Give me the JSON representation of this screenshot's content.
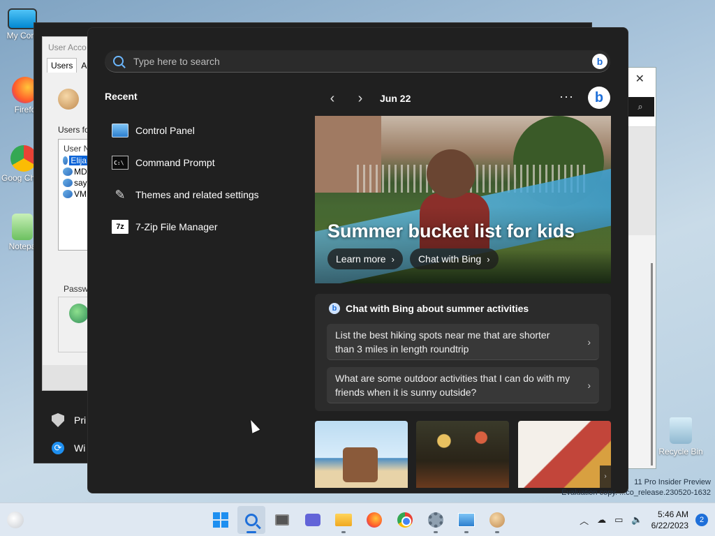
{
  "desktop": {
    "icons": [
      {
        "label": "My Com"
      },
      {
        "label": "Firefo"
      },
      {
        "label": "Goog Chron"
      },
      {
        "label": "Notepa"
      }
    ],
    "recycle_bin": "Recycle Bin",
    "watermark_line1": "11 Pro Insider Preview",
    "watermark_line2": "Evaluation copy. ...co_release.230520-1632"
  },
  "user_accounts_window": {
    "title": "User Acco",
    "tabs": [
      "Users",
      "Ad"
    ],
    "users_label": "Users fo",
    "list_header": "User N",
    "users": [
      "Elija",
      "MD",
      "say",
      "VM"
    ],
    "password_label": "Passw"
  },
  "background_menu": {
    "items": [
      "Pri",
      "Wi"
    ]
  },
  "search_flyout": {
    "search_placeholder": "Type here to search",
    "recent_title": "Recent",
    "recent_items": [
      {
        "label": "Control Panel",
        "icon": "control-panel-icon"
      },
      {
        "label": "Command Prompt",
        "icon": "command-prompt-icon"
      },
      {
        "label": "Themes and related settings",
        "icon": "brush-icon"
      },
      {
        "label": "7-Zip File Manager",
        "icon": "7zip-icon",
        "icon_text": "7z"
      }
    ],
    "date": "Jun 22",
    "hero": {
      "title": "Summer bucket list for kids",
      "learn_more": "Learn more",
      "chat_with_bing": "Chat with Bing"
    },
    "chat_card": {
      "heading": "Chat with Bing about summer activities",
      "prompts": [
        "List the best hiking spots near me that are shorter than 3 miles in length roundtrip",
        "What are some outdoor activities that I can do with my friends when it is sunny outside?"
      ]
    }
  },
  "taskbar": {
    "apps": [
      "start",
      "search",
      "task-view",
      "chat",
      "file-explorer",
      "firefox",
      "chrome",
      "settings",
      "control-panel",
      "user-accounts"
    ],
    "time": "5:46 AM",
    "date": "6/22/2023",
    "notification_count": "2"
  },
  "colors": {
    "flyout_bg": "#202020",
    "accent": "#1e6fd9",
    "taskbar_bg": "#dfe8f2"
  }
}
